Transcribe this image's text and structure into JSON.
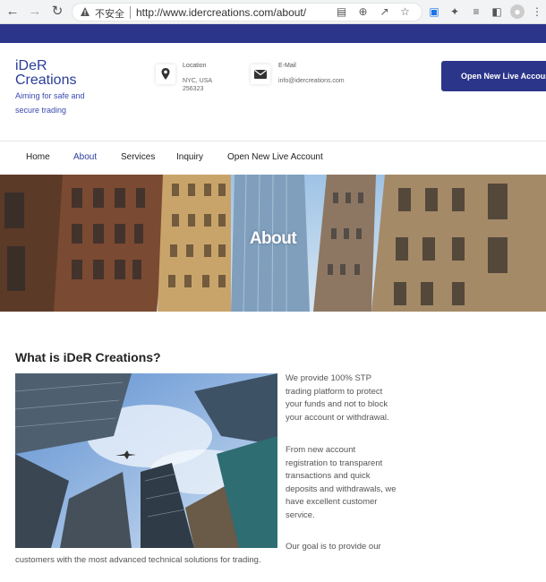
{
  "browser": {
    "insecure_label": "不安全",
    "url": "http://www.idercreations.com/about/"
  },
  "header": {
    "logo_line1": "iDeR",
    "logo_line2": "Creations",
    "tagline": "Aiming for safe and secure trading",
    "location_label": "Location",
    "location_line1": "NYC, USA",
    "location_line2": "256323",
    "email_label": "E-Mail",
    "email_value": "info@idercreations.com",
    "cta_label": "Open New Live Account"
  },
  "nav": {
    "items": [
      "Home",
      "About",
      "Services",
      "Inquiry",
      "Open New Live Account"
    ],
    "active": "About"
  },
  "hero": {
    "title": "About"
  },
  "content": {
    "heading": "What is iDeR Creations?",
    "para1": "We provide 100% STP trading platform to protect your funds and not to block your account or withdrawal.",
    "para2": "From new account registration to transparent transactions and quick deposits and withdrawals, we have excellent customer service.",
    "para3_start": "Our goal is to provide our",
    "para3_end": "customers with the most advanced technical solutions for trading."
  },
  "colors": {
    "brand": "#2b358a",
    "accent": "#2a3c9a"
  }
}
